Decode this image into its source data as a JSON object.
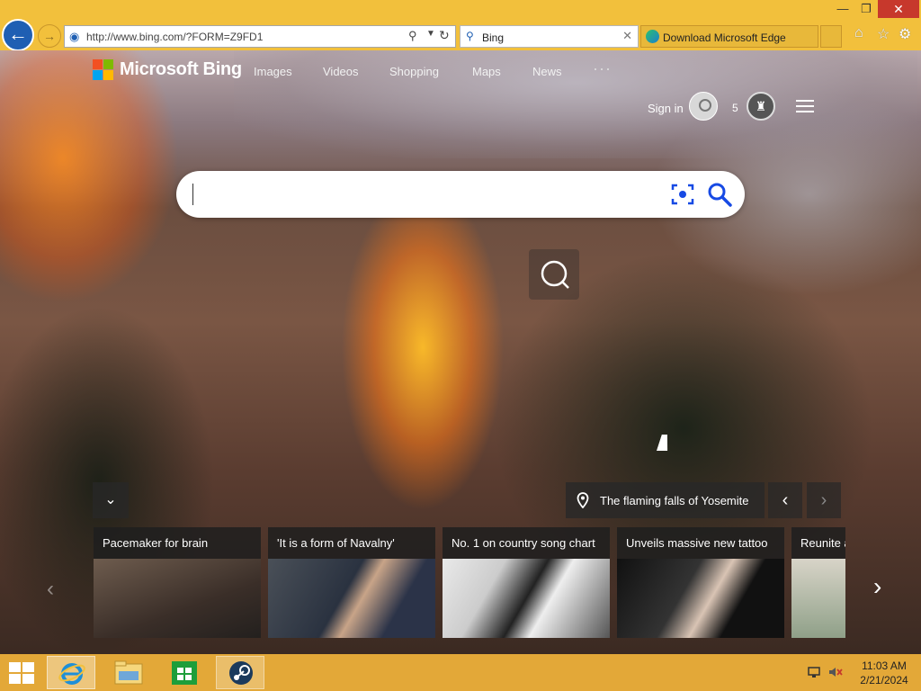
{
  "window": {
    "minimize_glyph": "—",
    "maximize_glyph": "❐",
    "close_glyph": "✕"
  },
  "browser": {
    "address": "http://www.bing.com/?FORM=Z9FD1",
    "tabs": [
      {
        "label": "Bing",
        "active": true
      },
      {
        "label": "Download Microsoft Edge",
        "active": false
      }
    ],
    "icons": [
      "back-arrow-icon",
      "forward-arrow-icon",
      "search-icon",
      "refresh-icon",
      "home-icon",
      "star-icon",
      "gear-icon"
    ]
  },
  "bing": {
    "logo_text": "Microsoft Bing",
    "nav": [
      "Images",
      "Videos",
      "Shopping",
      "Maps",
      "News"
    ],
    "nav_more": "···",
    "sign_in": "Sign in",
    "rewards_count": "5",
    "search_placeholder": ""
  },
  "image_of_day": {
    "title": "The flaming falls of Yosemite"
  },
  "news": [
    {
      "title": "Pacemaker for brain"
    },
    {
      "title": "'It is a form of Navalny'"
    },
    {
      "title": "No. 1 on country song chart"
    },
    {
      "title": "Unveils massive new tattoo"
    },
    {
      "title": "Reunite a"
    }
  ],
  "taskbar": {
    "apps": [
      "internet-explorer",
      "file-explorer",
      "store",
      "steam"
    ],
    "time": "11:03 AM",
    "date": "2/21/2024"
  },
  "colors": {
    "taskbar": "#e3a838",
    "titlebar": "#f2c03c",
    "close": "#c7382c",
    "bing_accent": "#174ae4"
  }
}
